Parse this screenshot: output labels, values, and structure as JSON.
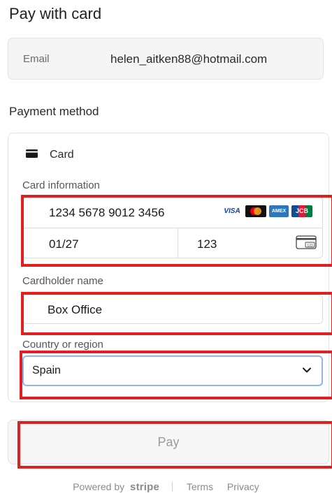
{
  "page_title": "Pay with card",
  "email": {
    "label": "Email",
    "value": "helen_aitken88@hotmail.com"
  },
  "payment_method": {
    "title": "Payment method",
    "tab_label": "Card",
    "tab_icon": "card-icon"
  },
  "card_info": {
    "label": "Card information",
    "number": "1234 5678 9012 3456",
    "expiry": "01/27",
    "cvc": "123",
    "brand_logos": [
      "VISA",
      "MC",
      "AMEX",
      "JCB"
    ]
  },
  "cardholder": {
    "label": "Cardholder name",
    "value": "Box Office"
  },
  "country": {
    "label": "Country or region",
    "value": "Spain"
  },
  "pay_button": {
    "label": "Pay"
  },
  "footer": {
    "powered_by": "Powered by",
    "brand": "stripe",
    "terms": "Terms",
    "privacy": "Privacy"
  },
  "colors": {
    "annotation": "#e02020",
    "focus_border": "#8fb4f0"
  }
}
